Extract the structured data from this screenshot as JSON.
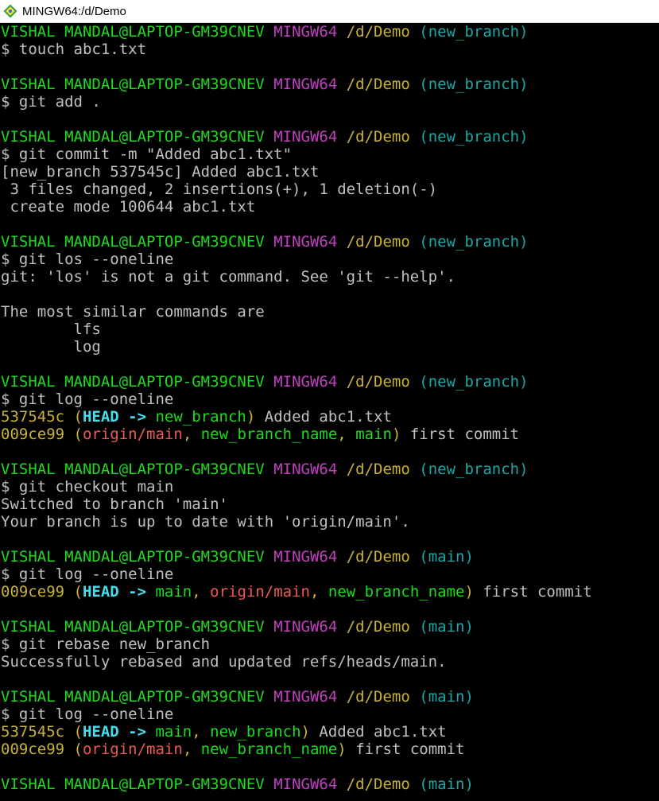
{
  "window": {
    "title": "MINGW64:/d/Demo",
    "icon": "git-bash-icon"
  },
  "colors": {
    "user_host": "#1edb1e",
    "msystem": "#c040c0",
    "path": "#c8b238",
    "branch_prompt": "#1ca6a6",
    "text": "#c0c0c0",
    "commit_hash": "#c8b238",
    "head": "#3ee0f0",
    "local_branch": "#1edb1e",
    "remote_branch": "#ee5a50"
  },
  "lines": [
    [
      {
        "t": "VISHAL MANDAL@LAPTOP-GM39CNEV",
        "c": "green"
      },
      {
        "t": " ",
        "c": "white"
      },
      {
        "t": "MINGW64",
        "c": "magenta"
      },
      {
        "t": " ",
        "c": "white"
      },
      {
        "t": "/d/Demo",
        "c": "yellow"
      },
      {
        "t": " ",
        "c": "white"
      },
      {
        "t": "(new_branch)",
        "c": "cyan"
      }
    ],
    [
      {
        "t": "$ touch abc1.txt",
        "c": "white"
      }
    ],
    [],
    [
      {
        "t": "VISHAL MANDAL@LAPTOP-GM39CNEV",
        "c": "green"
      },
      {
        "t": " ",
        "c": "white"
      },
      {
        "t": "MINGW64",
        "c": "magenta"
      },
      {
        "t": " ",
        "c": "white"
      },
      {
        "t": "/d/Demo",
        "c": "yellow"
      },
      {
        "t": " ",
        "c": "white"
      },
      {
        "t": "(new_branch)",
        "c": "cyan"
      }
    ],
    [
      {
        "t": "$ git add .",
        "c": "white"
      }
    ],
    [],
    [
      {
        "t": "VISHAL MANDAL@LAPTOP-GM39CNEV",
        "c": "green"
      },
      {
        "t": " ",
        "c": "white"
      },
      {
        "t": "MINGW64",
        "c": "magenta"
      },
      {
        "t": " ",
        "c": "white"
      },
      {
        "t": "/d/Demo",
        "c": "yellow"
      },
      {
        "t": " ",
        "c": "white"
      },
      {
        "t": "(new_branch)",
        "c": "cyan"
      }
    ],
    [
      {
        "t": "$ git commit -m \"Added abc1.txt\"",
        "c": "white"
      }
    ],
    [
      {
        "t": "[new_branch 537545c] Added abc1.txt",
        "c": "white"
      }
    ],
    [
      {
        "t": " 3 files changed, 2 insertions(+), 1 deletion(-)",
        "c": "white"
      }
    ],
    [
      {
        "t": " create mode 100644 abc1.txt",
        "c": "white"
      }
    ],
    [],
    [
      {
        "t": "VISHAL MANDAL@LAPTOP-GM39CNEV",
        "c": "green"
      },
      {
        "t": " ",
        "c": "white"
      },
      {
        "t": "MINGW64",
        "c": "magenta"
      },
      {
        "t": " ",
        "c": "white"
      },
      {
        "t": "/d/Demo",
        "c": "yellow"
      },
      {
        "t": " ",
        "c": "white"
      },
      {
        "t": "(new_branch)",
        "c": "cyan"
      }
    ],
    [
      {
        "t": "$ git los --oneline",
        "c": "white"
      }
    ],
    [
      {
        "t": "git: 'los' is not a git command. See 'git --help'.",
        "c": "white"
      }
    ],
    [],
    [
      {
        "t": "The most similar commands are",
        "c": "white"
      }
    ],
    [
      {
        "t": "        lfs",
        "c": "white"
      }
    ],
    [
      {
        "t": "        log",
        "c": "white"
      }
    ],
    [],
    [
      {
        "t": "VISHAL MANDAL@LAPTOP-GM39CNEV",
        "c": "green"
      },
      {
        "t": " ",
        "c": "white"
      },
      {
        "t": "MINGW64",
        "c": "magenta"
      },
      {
        "t": " ",
        "c": "white"
      },
      {
        "t": "/d/Demo",
        "c": "yellow"
      },
      {
        "t": " ",
        "c": "white"
      },
      {
        "t": "(new_branch)",
        "c": "cyan"
      }
    ],
    [
      {
        "t": "$ git log --oneline",
        "c": "white"
      }
    ],
    [
      {
        "t": "537545c",
        "c": "hash"
      },
      {
        "t": " (",
        "c": "hash"
      },
      {
        "t": "HEAD -> ",
        "c": "head"
      },
      {
        "t": "new_branch",
        "c": "branch"
      },
      {
        "t": ")",
        "c": "hash"
      },
      {
        "t": " Added abc1.txt",
        "c": "white"
      }
    ],
    [
      {
        "t": "009ce99",
        "c": "hash"
      },
      {
        "t": " (",
        "c": "hash"
      },
      {
        "t": "origin/main",
        "c": "remote"
      },
      {
        "t": ", ",
        "c": "hash"
      },
      {
        "t": "new_branch_name",
        "c": "branch"
      },
      {
        "t": ", ",
        "c": "hash"
      },
      {
        "t": "main",
        "c": "branch"
      },
      {
        "t": ")",
        "c": "hash"
      },
      {
        "t": " first commit",
        "c": "white"
      }
    ],
    [],
    [
      {
        "t": "VISHAL MANDAL@LAPTOP-GM39CNEV",
        "c": "green"
      },
      {
        "t": " ",
        "c": "white"
      },
      {
        "t": "MINGW64",
        "c": "magenta"
      },
      {
        "t": " ",
        "c": "white"
      },
      {
        "t": "/d/Demo",
        "c": "yellow"
      },
      {
        "t": " ",
        "c": "white"
      },
      {
        "t": "(new_branch)",
        "c": "cyan"
      }
    ],
    [
      {
        "t": "$ git checkout main",
        "c": "white"
      }
    ],
    [
      {
        "t": "Switched to branch 'main'",
        "c": "white"
      }
    ],
    [
      {
        "t": "Your branch is up to date with 'origin/main'.",
        "c": "white"
      }
    ],
    [],
    [
      {
        "t": "VISHAL MANDAL@LAPTOP-GM39CNEV",
        "c": "green"
      },
      {
        "t": " ",
        "c": "white"
      },
      {
        "t": "MINGW64",
        "c": "magenta"
      },
      {
        "t": " ",
        "c": "white"
      },
      {
        "t": "/d/Demo",
        "c": "yellow"
      },
      {
        "t": " ",
        "c": "white"
      },
      {
        "t": "(main)",
        "c": "cyan"
      }
    ],
    [
      {
        "t": "$ git log --oneline",
        "c": "white"
      }
    ],
    [
      {
        "t": "009ce99",
        "c": "hash"
      },
      {
        "t": " (",
        "c": "hash"
      },
      {
        "t": "HEAD -> ",
        "c": "head"
      },
      {
        "t": "main",
        "c": "branch"
      },
      {
        "t": ", ",
        "c": "hash"
      },
      {
        "t": "origin/main",
        "c": "remote"
      },
      {
        "t": ", ",
        "c": "hash"
      },
      {
        "t": "new_branch_name",
        "c": "branch"
      },
      {
        "t": ")",
        "c": "hash"
      },
      {
        "t": " first commit",
        "c": "white"
      }
    ],
    [],
    [
      {
        "t": "VISHAL MANDAL@LAPTOP-GM39CNEV",
        "c": "green"
      },
      {
        "t": " ",
        "c": "white"
      },
      {
        "t": "MINGW64",
        "c": "magenta"
      },
      {
        "t": " ",
        "c": "white"
      },
      {
        "t": "/d/Demo",
        "c": "yellow"
      },
      {
        "t": " ",
        "c": "white"
      },
      {
        "t": "(main)",
        "c": "cyan"
      }
    ],
    [
      {
        "t": "$ git rebase new_branch",
        "c": "white"
      }
    ],
    [
      {
        "t": "Successfully rebased and updated refs/heads/main.",
        "c": "white"
      }
    ],
    [],
    [
      {
        "t": "VISHAL MANDAL@LAPTOP-GM39CNEV",
        "c": "green"
      },
      {
        "t": " ",
        "c": "white"
      },
      {
        "t": "MINGW64",
        "c": "magenta"
      },
      {
        "t": " ",
        "c": "white"
      },
      {
        "t": "/d/Demo",
        "c": "yellow"
      },
      {
        "t": " ",
        "c": "white"
      },
      {
        "t": "(main)",
        "c": "cyan"
      }
    ],
    [
      {
        "t": "$ git log --oneline",
        "c": "white"
      }
    ],
    [
      {
        "t": "537545c",
        "c": "hash"
      },
      {
        "t": " (",
        "c": "hash"
      },
      {
        "t": "HEAD -> ",
        "c": "head"
      },
      {
        "t": "main",
        "c": "branch"
      },
      {
        "t": ", ",
        "c": "hash"
      },
      {
        "t": "new_branch",
        "c": "branch"
      },
      {
        "t": ")",
        "c": "hash"
      },
      {
        "t": " Added abc1.txt",
        "c": "white"
      }
    ],
    [
      {
        "t": "009ce99",
        "c": "hash"
      },
      {
        "t": " (",
        "c": "hash"
      },
      {
        "t": "origin/main",
        "c": "remote"
      },
      {
        "t": ", ",
        "c": "hash"
      },
      {
        "t": "new_branch_name",
        "c": "branch"
      },
      {
        "t": ")",
        "c": "hash"
      },
      {
        "t": " first commit",
        "c": "white"
      }
    ],
    [],
    [
      {
        "t": "VISHAL MANDAL@LAPTOP-GM39CNEV",
        "c": "green"
      },
      {
        "t": " ",
        "c": "white"
      },
      {
        "t": "MINGW64",
        "c": "magenta"
      },
      {
        "t": " ",
        "c": "white"
      },
      {
        "t": "/d/Demo",
        "c": "yellow"
      },
      {
        "t": " ",
        "c": "white"
      },
      {
        "t": "(main)",
        "c": "cyan"
      }
    ]
  ]
}
